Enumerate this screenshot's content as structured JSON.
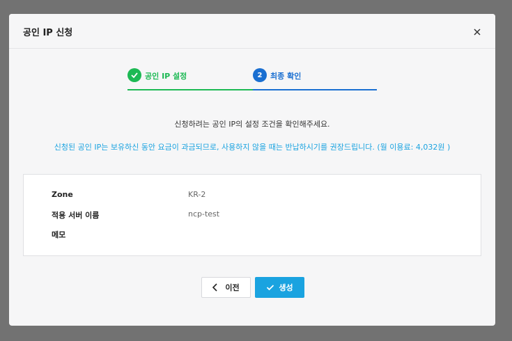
{
  "modal": {
    "title": "공인 IP 신청"
  },
  "stepper": {
    "steps": [
      {
        "number": "",
        "label": "공인 IP 설정",
        "status": "done"
      },
      {
        "number": "2",
        "label": "최종 확인",
        "status": "active"
      }
    ]
  },
  "content": {
    "confirm_message": "신청하려는 공인 IP의 설정 조건을 확인해주세요.",
    "notice_message": "신청된 공인 IP는 보유하신 동안 요금이 과금되므로, 사용하지 않을 때는 반납하시기를 권장드립니다. (월 이용료: 4,032원 )"
  },
  "details": [
    {
      "label": "Zone",
      "value": "KR-2"
    },
    {
      "label": "적용 서버 이름",
      "value": "ncp-test"
    },
    {
      "label": "메모",
      "value": ""
    }
  ],
  "buttons": {
    "prev_label": "이전",
    "create_label": "생성"
  },
  "colors": {
    "done_green": "#1db954",
    "active_blue": "#1a6fd1",
    "accent_cyan": "#1aa3e0"
  },
  "icons": {
    "close": "close-icon",
    "step_done": "check-icon",
    "prev": "chevron-left-icon",
    "create": "check-icon"
  }
}
